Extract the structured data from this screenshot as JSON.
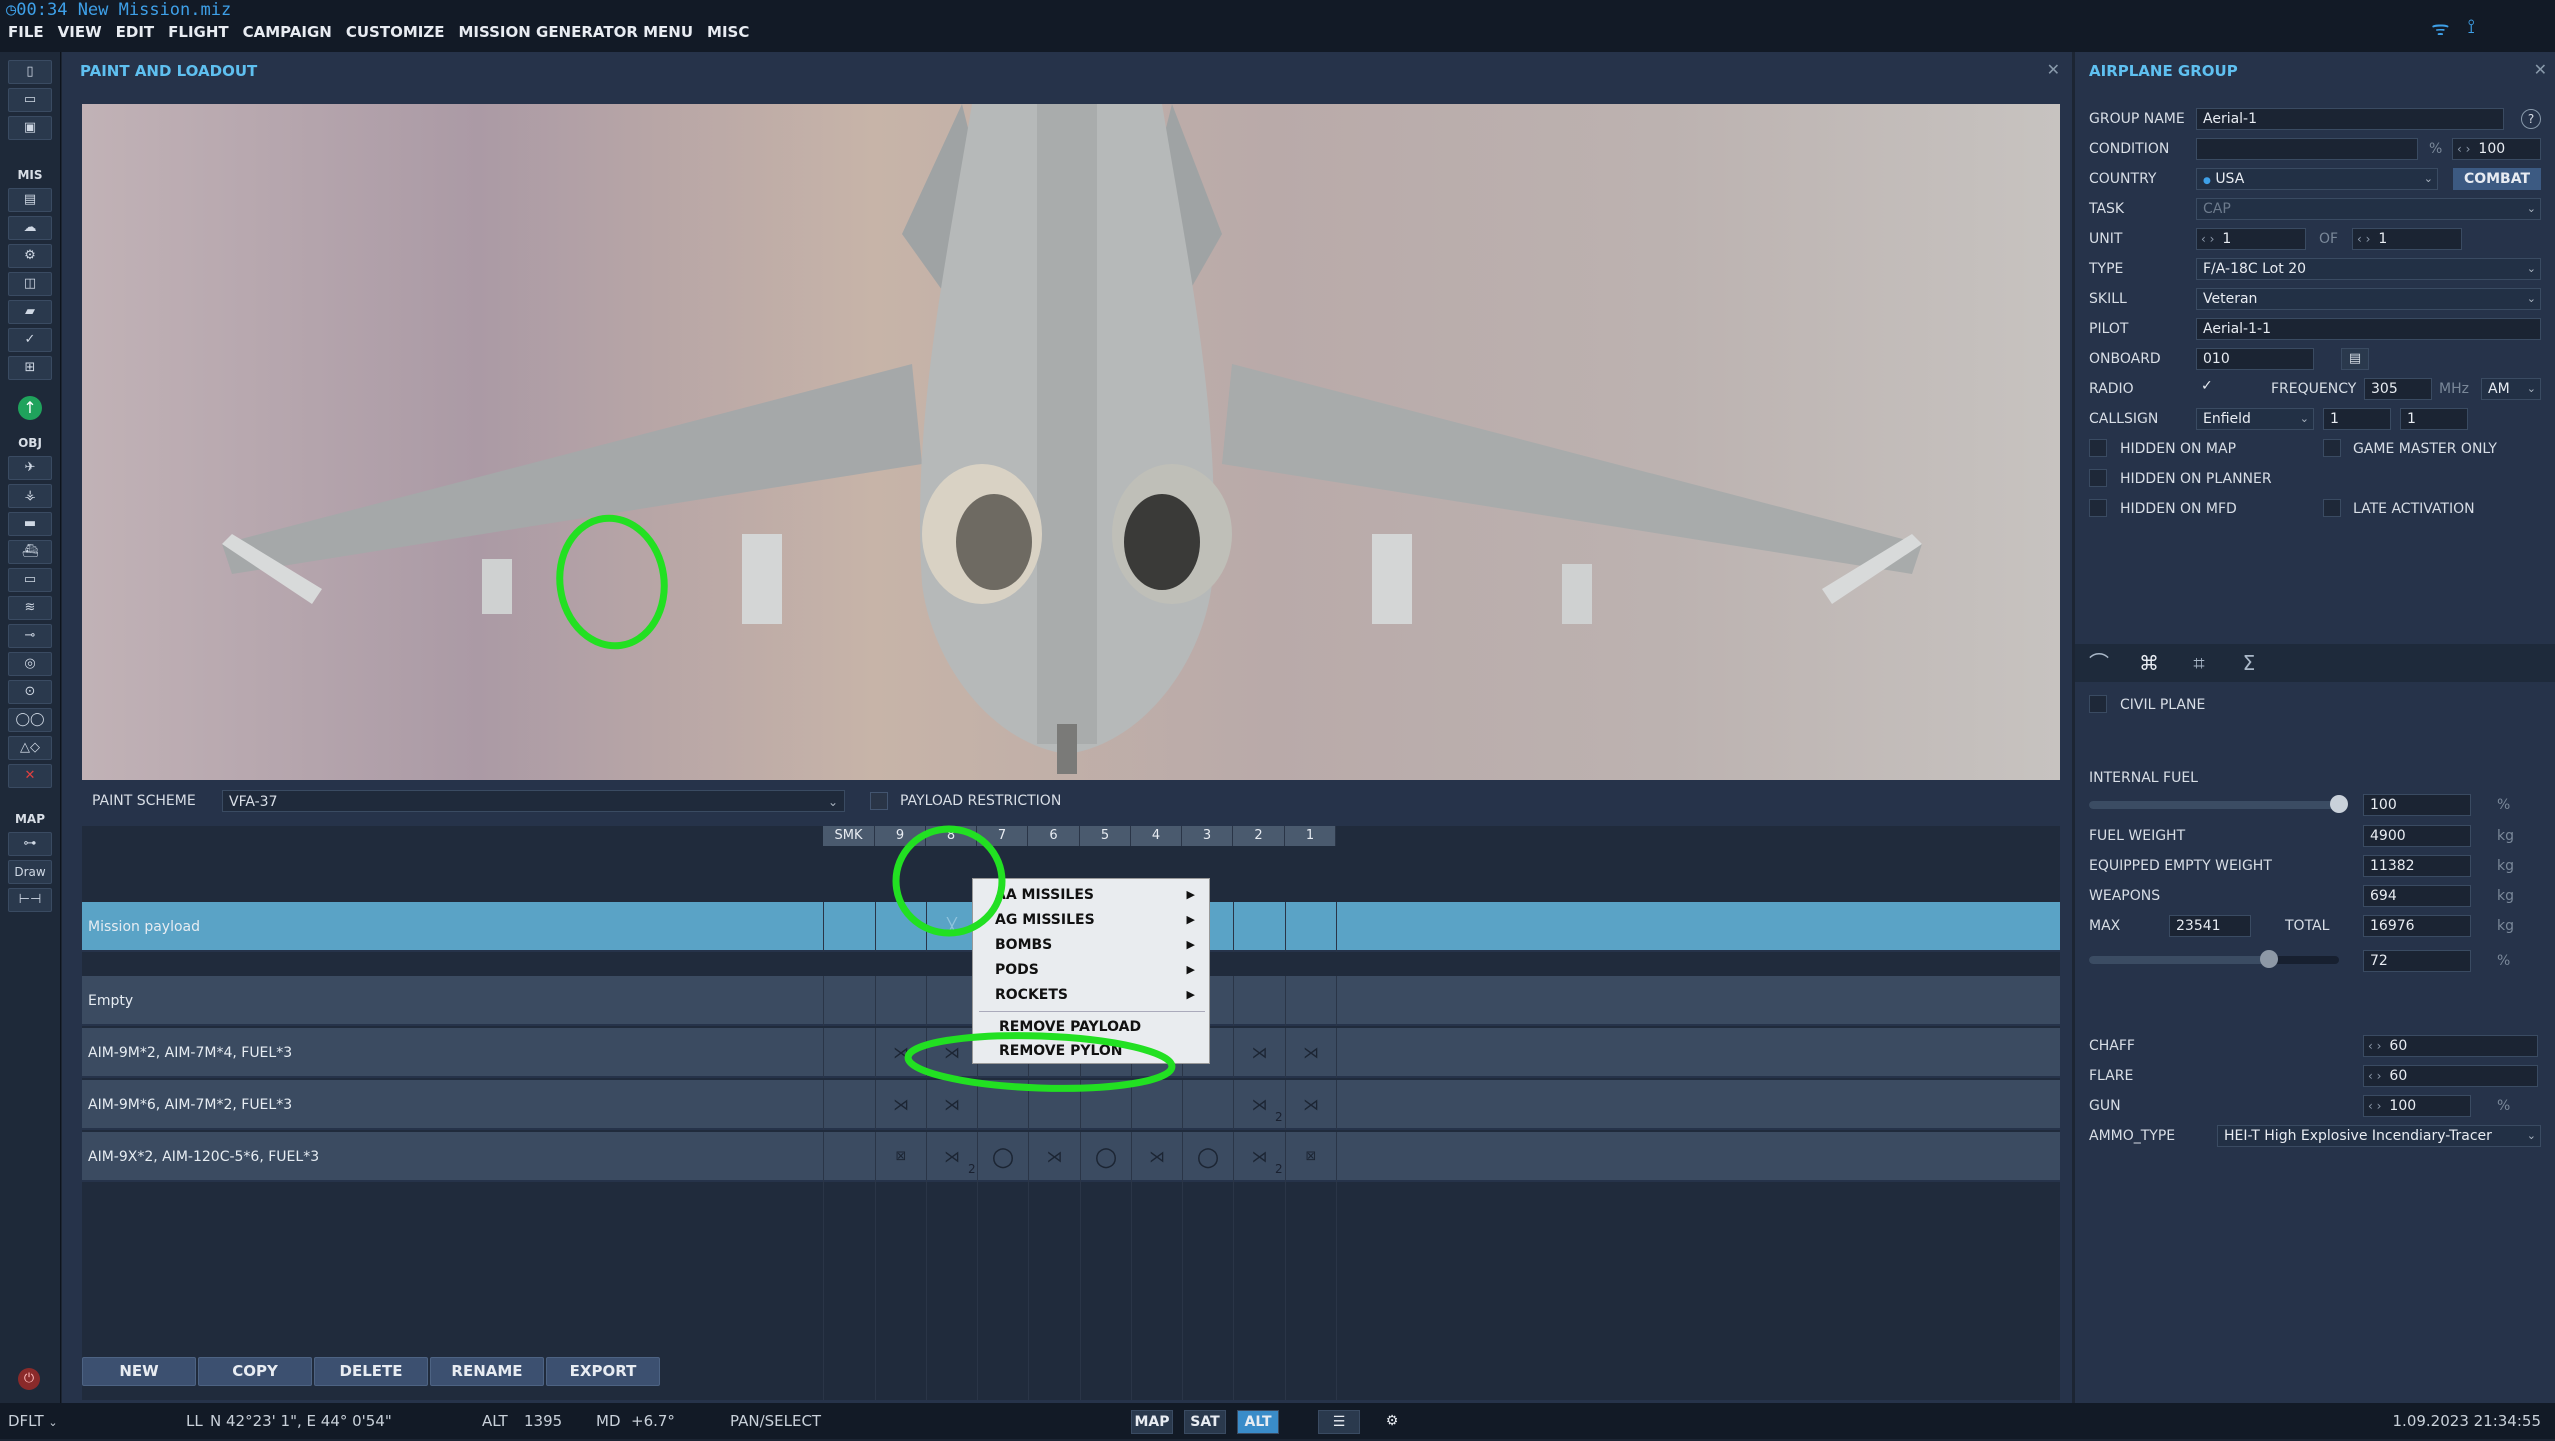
{
  "app": {
    "clock": "00:34",
    "file_name": "New Mission.miz",
    "menu": [
      "FILE",
      "VIEW",
      "EDIT",
      "FLIGHT",
      "CAMPAIGN",
      "CUSTOMIZE",
      "MISSION GENERATOR MENU",
      "MISC"
    ]
  },
  "left_toolbar": {
    "mis_label": "MIS",
    "obj_label": "OBJ",
    "map_label": "MAP",
    "draw_label": "Draw"
  },
  "paint_loadout": {
    "title": "PAINT AND LOADOUT",
    "paint_scheme_label": "PAINT SCHEME",
    "paint_scheme_value": "VFA-37",
    "payload_restriction_label": "PAYLOAD RESTRICTION",
    "pylon_columns": [
      "SMK",
      "9",
      "8",
      "7",
      "6",
      "5",
      "4",
      "3",
      "2",
      "1"
    ],
    "rows": [
      {
        "name": "Mission payload",
        "selected": true
      },
      {
        "name": "Empty"
      },
      {
        "name": "AIM-9M*2, AIM-7M*4, FUEL*3"
      },
      {
        "name": "AIM-9M*6, AIM-7M*2, FUEL*3"
      },
      {
        "name": "AIM-9X*2, AIM-120C-5*6, FUEL*3"
      }
    ],
    "counts": {
      "a": "2",
      "b": "2",
      "c": "2"
    },
    "context_menu": {
      "items": [
        "AA MISSILES",
        "AG MISSILES",
        "BOMBS",
        "PODS",
        "ROCKETS"
      ],
      "remove_payload": "REMOVE PAYLOAD",
      "remove_pylon": "REMOVE PYLON"
    },
    "buttons": [
      "NEW",
      "COPY",
      "DELETE",
      "RENAME",
      "EXPORT"
    ]
  },
  "airplane_group": {
    "title": "AIRPLANE GROUP",
    "group_name_label": "GROUP NAME",
    "group_name": "Aerial-1",
    "help": "?",
    "condition_label": "CONDITION",
    "condition_unit": "%",
    "condition_value": "100",
    "country_label": "COUNTRY",
    "country": "USA",
    "combat_button": "COMBAT",
    "task_label": "TASK",
    "task": "CAP",
    "unit_label": "UNIT",
    "unit_value": "1",
    "of_label": "OF",
    "of_value": "1",
    "type_label": "TYPE",
    "type": "F/A-18C Lot 20",
    "skill_label": "SKILL",
    "skill": "Veteran",
    "pilot_label": "PILOT",
    "pilot": "Aerial-1-1",
    "onboard_label": "ONBOARD",
    "onboard": "010",
    "radio_label": "RADIO",
    "frequency_label": "FREQUENCY",
    "frequency": "305",
    "freq_unit": "MHz",
    "modulation": "AM",
    "callsign_label": "CALLSIGN",
    "callsign": "Enfield",
    "callsign_n1": "1",
    "callsign_n2": "1",
    "hidden_on_map": "HIDDEN ON MAP",
    "game_master_only": "GAME MASTER ONLY",
    "hidden_on_planner": "HIDDEN ON PLANNER",
    "late_activation": "LATE ACTIVATION",
    "hidden_on_mfd": "HIDDEN ON MFD",
    "civil_plane": "CIVIL PLANE",
    "internal_fuel_label": "INTERNAL FUEL",
    "internal_fuel_value": "100",
    "internal_fuel_fraction": 1.0,
    "pct": "%",
    "kg": "kg",
    "fuel_weight_label": "FUEL WEIGHT",
    "fuel_weight": "4900",
    "equipped_empty_weight_label": "EQUIPPED EMPTY WEIGHT",
    "equipped_empty_weight": "11382",
    "weapons_label": "WEAPONS",
    "weapons": "694",
    "max_label": "MAX",
    "max": "23541",
    "total_label": "TOTAL",
    "total": "16976",
    "load_pct": "72",
    "load_fraction": 0.72,
    "chaff_label": "CHAFF",
    "chaff": "60",
    "flare_label": "FLARE",
    "flare": "60",
    "gun_label": "GUN",
    "gun": "100",
    "ammo_type_label": "AMMO_TYPE",
    "ammo_type": "HEI-T High Explosive Incendiary-Tracer"
  },
  "statusbar": {
    "profile": "DFLT",
    "coord_mode": "LL",
    "coords": "N 42°23' 1\", E 44° 0'54\"",
    "alt_label": "ALT",
    "alt": "1395",
    "md_label": "MD",
    "md": "+6.7°",
    "mode": "PAN/SELECT",
    "map_btn": "MAP",
    "sat_btn": "SAT",
    "alt_btn": "ALT",
    "datetime": "1.09.2023 21:34:55"
  },
  "colors": {
    "accent": "#5fc0f0",
    "selected_row": "#5aa3c6",
    "annotation": "#22e022"
  }
}
